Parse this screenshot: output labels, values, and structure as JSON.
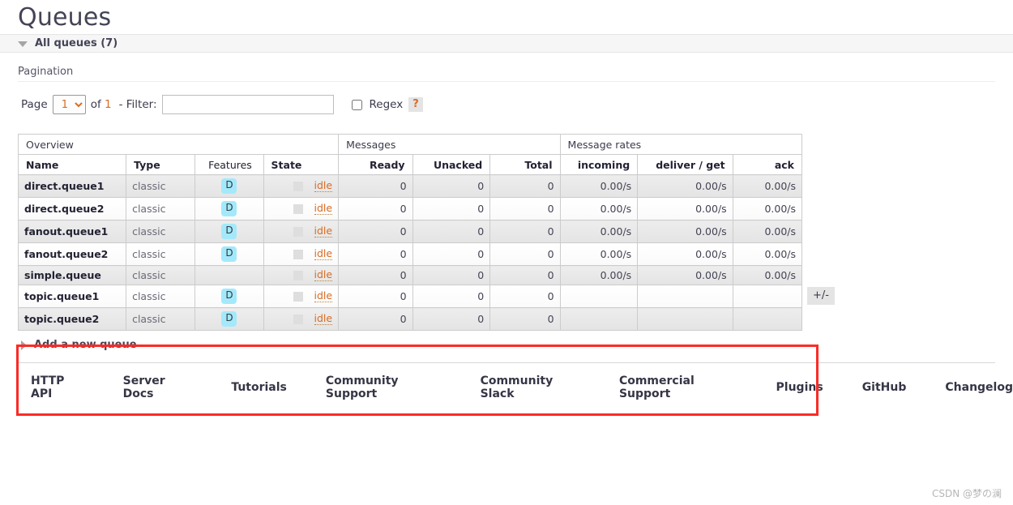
{
  "header": {
    "title": "Queues",
    "section_label": "All queues (7)",
    "collapse_icon": "triangle-down-icon"
  },
  "pagination": {
    "label": "Pagination",
    "page_label": "Page",
    "page_value": "1",
    "page_options": [
      "1"
    ],
    "of_label": "of",
    "total_pages": "1",
    "filter_label": "- Filter:",
    "filter_value": "",
    "filter_placeholder": "",
    "regex_label": "Regex",
    "regex_checked": false,
    "help_label": "?"
  },
  "table": {
    "group_headers": [
      {
        "label": "Overview",
        "span": 4
      },
      {
        "label": "Messages",
        "span": 3
      },
      {
        "label": "Message rates",
        "span": 3
      }
    ],
    "columns": [
      {
        "key": "name",
        "label": "Name",
        "bold": true,
        "align": "left"
      },
      {
        "key": "type",
        "label": "Type",
        "bold": true,
        "align": "left"
      },
      {
        "key": "features",
        "label": "Features",
        "bold": false,
        "align": "center"
      },
      {
        "key": "state",
        "label": "State",
        "bold": true,
        "align": "left"
      },
      {
        "key": "ready",
        "label": "Ready",
        "bold": true,
        "align": "right"
      },
      {
        "key": "unacked",
        "label": "Unacked",
        "bold": true,
        "align": "right"
      },
      {
        "key": "total",
        "label": "Total",
        "bold": true,
        "align": "right"
      },
      {
        "key": "incoming",
        "label": "incoming",
        "bold": true,
        "align": "right"
      },
      {
        "key": "deliver_get",
        "label": "deliver / get",
        "bold": true,
        "align": "right"
      },
      {
        "key": "ack",
        "label": "ack",
        "bold": true,
        "align": "right"
      }
    ],
    "toggle_columns_label": "+/-",
    "rows": [
      {
        "name": "direct.queue1",
        "type": "classic",
        "features": "D",
        "state": "idle",
        "ready": "0",
        "unacked": "0",
        "total": "0",
        "incoming": "0.00/s",
        "deliver_get": "0.00/s",
        "ack": "0.00/s"
      },
      {
        "name": "direct.queue2",
        "type": "classic",
        "features": "D",
        "state": "idle",
        "ready": "0",
        "unacked": "0",
        "total": "0",
        "incoming": "0.00/s",
        "deliver_get": "0.00/s",
        "ack": "0.00/s"
      },
      {
        "name": "fanout.queue1",
        "type": "classic",
        "features": "D",
        "state": "idle",
        "ready": "0",
        "unacked": "0",
        "total": "0",
        "incoming": "0.00/s",
        "deliver_get": "0.00/s",
        "ack": "0.00/s"
      },
      {
        "name": "fanout.queue2",
        "type": "classic",
        "features": "D",
        "state": "idle",
        "ready": "0",
        "unacked": "0",
        "total": "0",
        "incoming": "0.00/s",
        "deliver_get": "0.00/s",
        "ack": "0.00/s"
      },
      {
        "name": "simple.queue",
        "type": "classic",
        "features": "",
        "state": "idle",
        "ready": "0",
        "unacked": "0",
        "total": "0",
        "incoming": "0.00/s",
        "deliver_get": "0.00/s",
        "ack": "0.00/s"
      },
      {
        "name": "topic.queue1",
        "type": "classic",
        "features": "D",
        "state": "idle",
        "ready": "0",
        "unacked": "0",
        "total": "0",
        "incoming": "",
        "deliver_get": "",
        "ack": ""
      },
      {
        "name": "topic.queue2",
        "type": "classic",
        "features": "D",
        "state": "idle",
        "ready": "0",
        "unacked": "0",
        "total": "0",
        "incoming": "",
        "deliver_get": "",
        "ack": ""
      }
    ]
  },
  "annotation": {
    "highlight_color": "#fb2b26"
  },
  "add_queue": {
    "label": "Add a new queue",
    "expand_icon": "triangle-right-icon"
  },
  "footer": {
    "links": [
      "HTTP API",
      "Server Docs",
      "Tutorials",
      "Community Support",
      "Community Slack",
      "Commercial Support",
      "Plugins",
      "GitHub",
      "Changelog"
    ],
    "watermark": "CSDN @梦の澜"
  }
}
